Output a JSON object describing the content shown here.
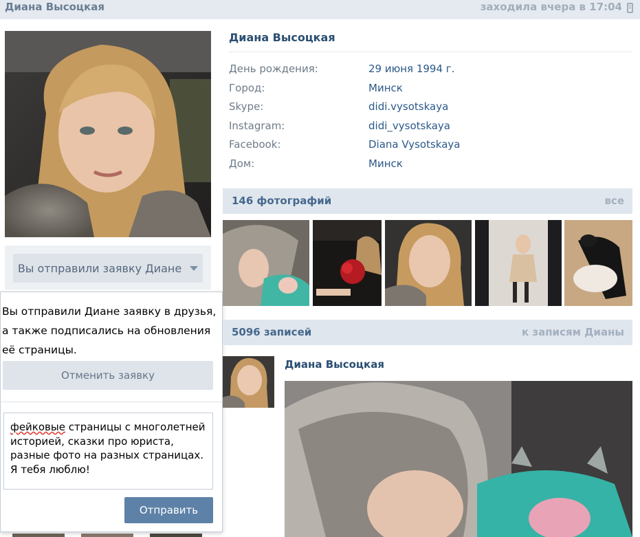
{
  "topbar": {
    "name": "Диана Высоцкая",
    "last_seen": "заходила вчера в 17:04",
    "device_icon": "phone-icon"
  },
  "request": {
    "button_label": "Вы отправили заявку Диане",
    "popup_message": "Вы отправили Диане заявку в друзья, а также подписались на обновления её страницы.",
    "cancel_label": "Отменить заявку",
    "message_text_underlined": "фейковые",
    "message_text_rest": " страницы с многолетней историей, сказки про юриста, разные фото на разных страницах. Я тебя люблю!",
    "send_label": "Отправить"
  },
  "profile": {
    "name": "Диана Высоцкая",
    "info": [
      {
        "label": "День рождения:",
        "value": "29 июня 1994 г."
      },
      {
        "label": "Город:",
        "value": "Минск"
      },
      {
        "label": "Skype:",
        "value": "didi.vysotskaya"
      },
      {
        "label": "Instagram:",
        "value": "didi_vysotskaya"
      },
      {
        "label": "Facebook:",
        "value": "Diana Vysotskaya"
      },
      {
        "label": "Дом:",
        "value": "Минск"
      }
    ]
  },
  "photos": {
    "title": "146 фотографий",
    "all_link": "все"
  },
  "posts": {
    "title": "5096 записей",
    "link": "к записям Дианы",
    "first_post_author": "Диана Высоцкая"
  },
  "colors": {
    "link_blue": "#2b5888",
    "header_bg": "#e0e6ed",
    "button_blue": "#5e81a8"
  }
}
